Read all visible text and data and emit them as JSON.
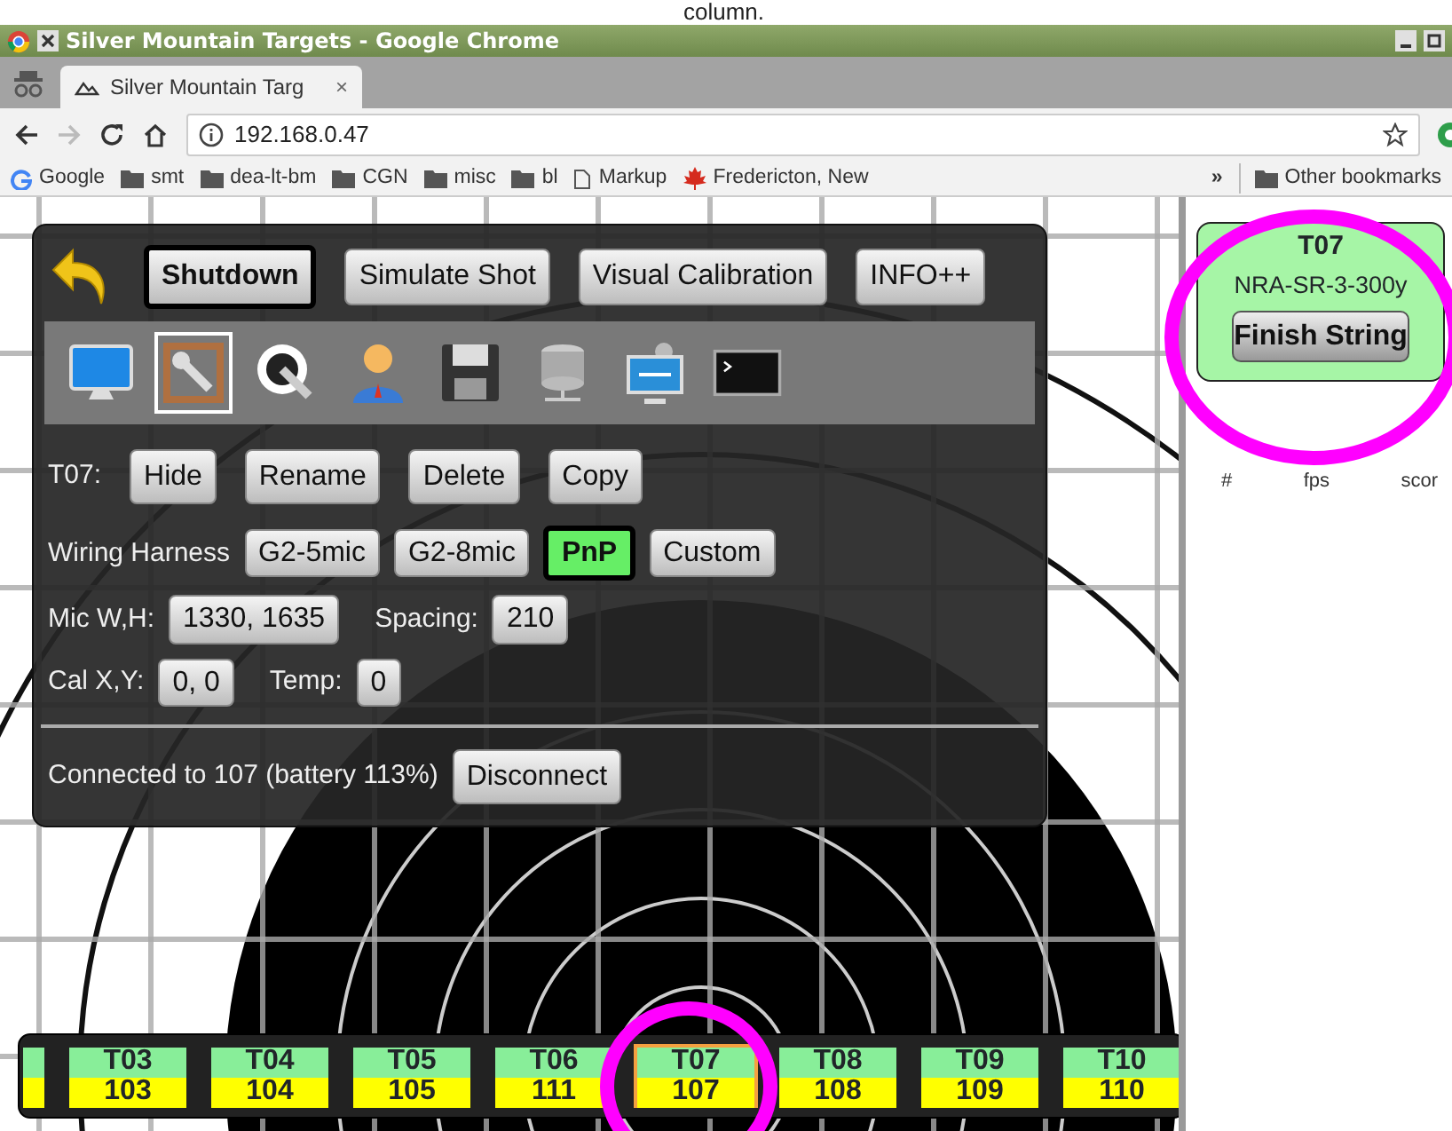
{
  "caption_fragment": "column.",
  "browser": {
    "title": "Silver Mountain Targets - Google Chrome",
    "tabs": [
      {
        "label": "Silver Mountain Targ",
        "close": "×",
        "selected": true
      }
    ],
    "address": "192.168.0.47",
    "bookmarks": [
      {
        "label": "Google",
        "kind": "google"
      },
      {
        "label": "smt",
        "kind": "folder"
      },
      {
        "label": "dea-lt-bm",
        "kind": "folder"
      },
      {
        "label": "CGN",
        "kind": "folder"
      },
      {
        "label": "misc",
        "kind": "folder"
      },
      {
        "label": "bl",
        "kind": "folder"
      },
      {
        "label": "Markup",
        "kind": "page"
      },
      {
        "label": "Fredericton, New",
        "kind": "leaf"
      }
    ],
    "overflow": "»",
    "other_bookmarks": "Other bookmarks"
  },
  "panel": {
    "buttons": [
      {
        "label": "Shutdown",
        "emphasized": true
      },
      {
        "label": "Simulate Shot",
        "emphasized": false
      },
      {
        "label": "Visual Calibration",
        "emphasized": false
      },
      {
        "label": "INFO++",
        "emphasized": false
      }
    ],
    "tools": [
      {
        "kind": "monitor",
        "selected": false
      },
      {
        "kind": "wrench-frame",
        "selected": true
      },
      {
        "kind": "wrench-circle",
        "selected": false
      },
      {
        "kind": "person",
        "selected": false
      },
      {
        "kind": "floppy",
        "selected": false
      },
      {
        "kind": "database",
        "selected": false
      },
      {
        "kind": "usb",
        "selected": false
      },
      {
        "kind": "terminal",
        "selected": false
      }
    ],
    "target_label": "T07:",
    "target_actions": [
      "Hide",
      "Rename",
      "Delete",
      "Copy"
    ],
    "harness": {
      "label": "Wiring Harness",
      "options": [
        {
          "label": "G2-5mic",
          "selected": false
        },
        {
          "label": "G2-8mic",
          "selected": false
        },
        {
          "label": "PnP",
          "selected": true
        },
        {
          "label": "Custom",
          "selected": false
        }
      ]
    },
    "settings": [
      [
        {
          "label": "Mic W,H:",
          "value": "1330, 1635"
        },
        {
          "label": "Spacing:",
          "value": "210"
        }
      ],
      [
        {
          "label": "Cal X,Y:",
          "value": "0, 0"
        },
        {
          "label": "Temp:",
          "value": "0"
        }
      ]
    ],
    "status": "Connected to 107 (battery 113%)",
    "disconnect": "Disconnect"
  },
  "sidebar": {
    "target": "T07",
    "profile": "NRA-SR-3-300y",
    "action": "Finish String",
    "columns": [
      "#",
      "fps",
      "scor"
    ]
  },
  "target_bar": [
    {
      "name": "T03",
      "number": "103",
      "selected": false
    },
    {
      "name": "T04",
      "number": "104",
      "selected": false
    },
    {
      "name": "T05",
      "number": "105",
      "selected": false
    },
    {
      "name": "T06",
      "number": "111",
      "selected": false
    },
    {
      "name": "T07",
      "number": "107",
      "selected": true
    },
    {
      "name": "T08",
      "number": "108",
      "selected": false
    },
    {
      "name": "T09",
      "number": "109",
      "selected": false
    },
    {
      "name": "T10",
      "number": "110",
      "selected": false
    }
  ]
}
